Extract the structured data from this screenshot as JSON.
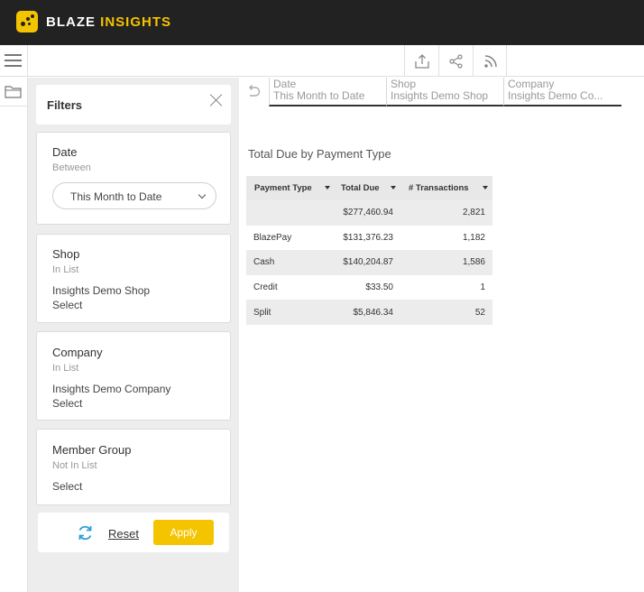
{
  "brand": {
    "word1": "BLAZE",
    "word2": "INSIGHTS",
    "accent_color": "#f5c400",
    "bar_color": "#222222"
  },
  "toolbar": {
    "icons": [
      "menu-icon",
      "export-icon",
      "share-icon",
      "rss-feed-icon"
    ]
  },
  "rail": {
    "icons": [
      "folder-icon"
    ]
  },
  "filters": {
    "title": "Filters",
    "cards": [
      {
        "title": "Date",
        "operator": "Between",
        "dropdown_value": "This Month to Date"
      },
      {
        "title": "Shop",
        "operator": "In List",
        "value": "Insights Demo Shop",
        "select": "Select"
      },
      {
        "title": "Company",
        "operator": "In List",
        "value": "Insights Demo Company",
        "select": "Select"
      },
      {
        "title": "Member Group",
        "operator": "Not In List",
        "select": "Select"
      }
    ],
    "reset_label": "Reset",
    "apply_label": "Apply"
  },
  "chips": [
    {
      "label": "Date",
      "value": "This Month to Date"
    },
    {
      "label": "Shop",
      "value": "Insights Demo Shop"
    },
    {
      "label": "Company",
      "value": "Insights Demo Co..."
    }
  ],
  "report": {
    "title": "Total Due by Payment Type",
    "columns": [
      "Payment Type",
      "Total Due",
      "# Transactions"
    ],
    "total_row": {
      "payment_type": "",
      "total_due": "$277,460.94",
      "transactions": "2,821"
    },
    "rows": [
      {
        "payment_type": "BlazePay",
        "total_due": "$131,376.23",
        "transactions": "1,182"
      },
      {
        "payment_type": "Cash",
        "total_due": "$140,204.87",
        "transactions": "1,586"
      },
      {
        "payment_type": "Credit",
        "total_due": "$33.50",
        "transactions": "1"
      },
      {
        "payment_type": "Split",
        "total_due": "$5,846.34",
        "transactions": "52"
      }
    ]
  }
}
